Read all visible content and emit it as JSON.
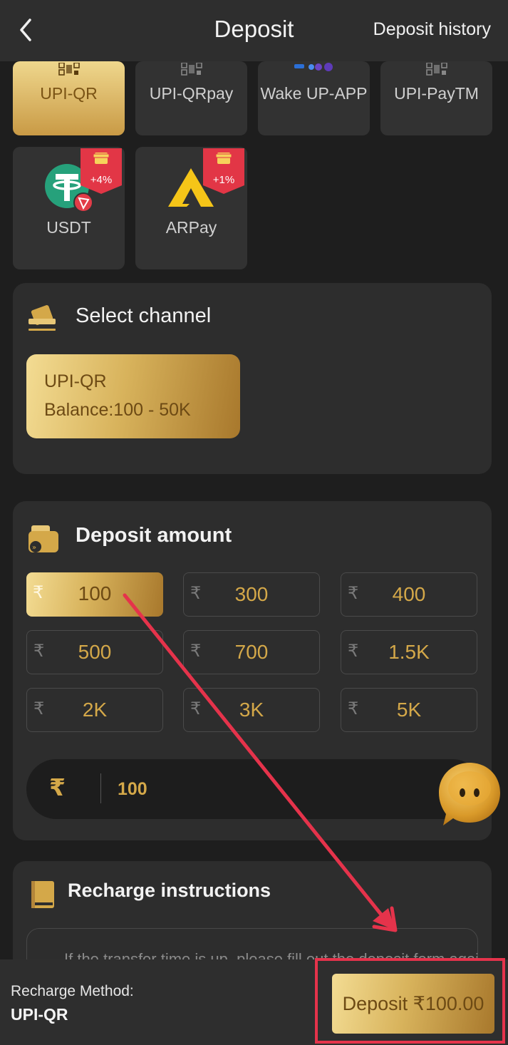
{
  "header": {
    "title": "Deposit",
    "history_label": "Deposit history"
  },
  "methods": [
    {
      "label": "UPI-QR",
      "icon": "qr-icon",
      "active": true
    },
    {
      "label": "UPI-QRpay",
      "icon": "qr-icon"
    },
    {
      "label": "Wake UP-APP",
      "icon": "upi-apps-icon"
    },
    {
      "label": "UPI-PayTM",
      "icon": "qr-icon"
    },
    {
      "label": "USDT",
      "icon": "tether-icon",
      "badge": "+4%"
    },
    {
      "label": "ARPay",
      "icon": "arpay-logo-icon",
      "badge": "+1%"
    }
  ],
  "channel": {
    "title": "Select channel",
    "option_name": "UPI-QR",
    "option_balance": "Balance:100 - 50K"
  },
  "amount": {
    "title": "Deposit amount",
    "currency_symbol": "₹",
    "presets": [
      "100",
      "300",
      "400",
      "500",
      "700",
      "1.5K",
      "2K",
      "3K",
      "5K"
    ],
    "selected_index": 0,
    "input_value": "100"
  },
  "instructions": {
    "title": "Recharge instructions",
    "first_line": "If the transfer time is up, please fill out the deposit form again."
  },
  "bottom": {
    "method_label": "Recharge Method:",
    "method_value": "UPI-QR",
    "deposit_button": "Deposit ₹100.00"
  },
  "colors": {
    "accent_gold": "#d4a849",
    "annotation_red": "#e5334b",
    "background": "#1e1e1e"
  }
}
